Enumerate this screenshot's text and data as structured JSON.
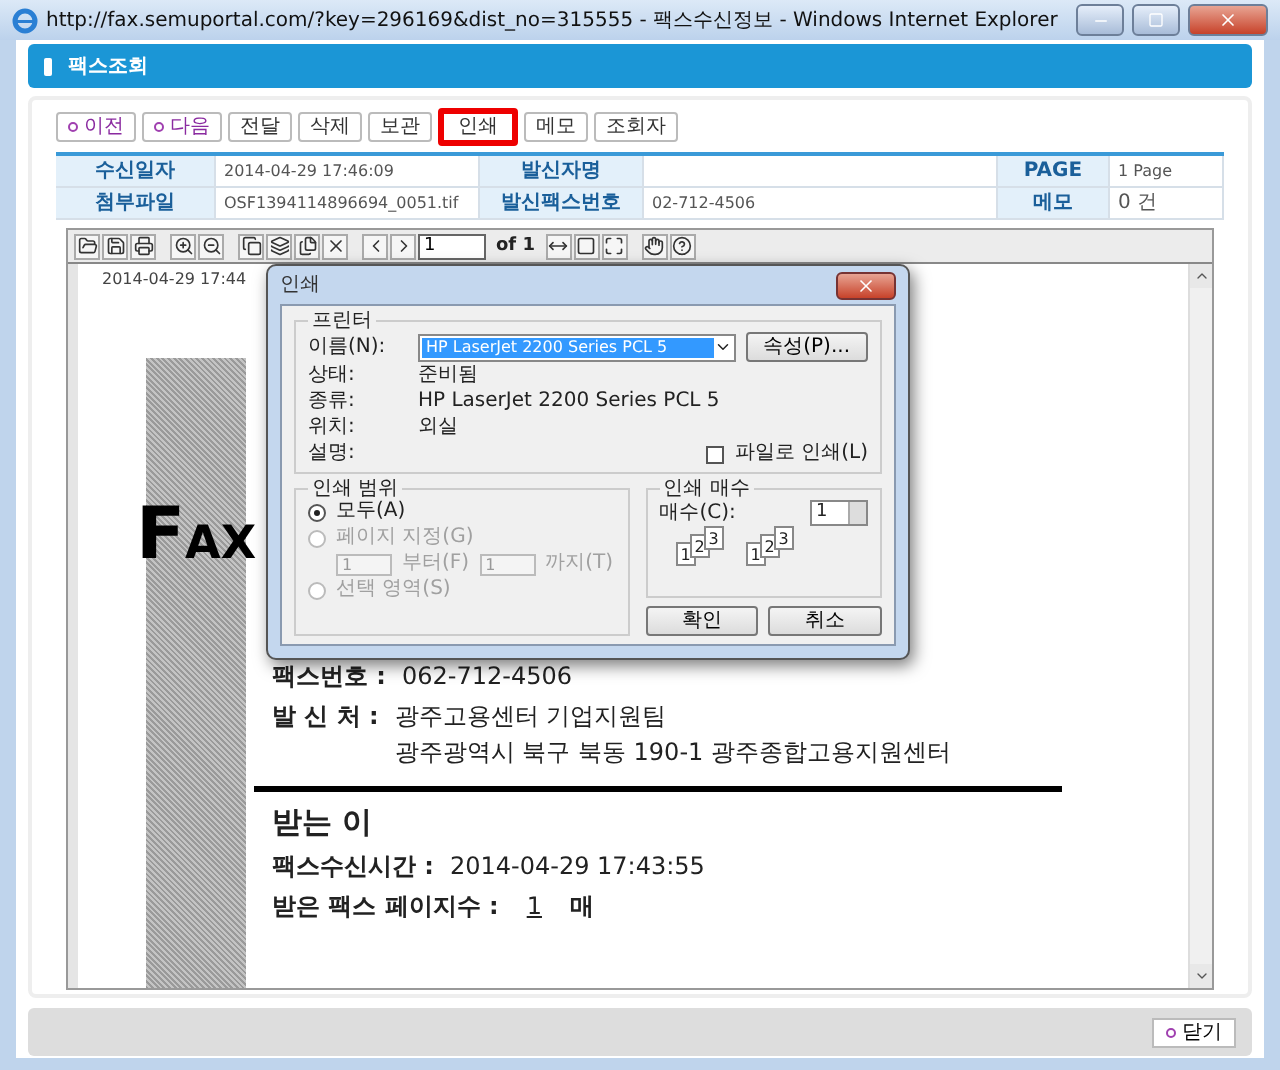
{
  "window": {
    "title": "http://fax.semuportal.com/?key=296169&dist_no=315555 - 팩스수신정보 - Windows Internet Explorer"
  },
  "header": {
    "title": "팩스조회"
  },
  "actions": [
    {
      "label": "이전",
      "kind": "nav",
      "selected": false
    },
    {
      "label": "다음",
      "kind": "nav",
      "selected": false
    },
    {
      "label": "전달",
      "kind": "plain",
      "selected": false
    },
    {
      "label": "삭제",
      "kind": "plain",
      "selected": false
    },
    {
      "label": "보관",
      "kind": "plain",
      "selected": false
    },
    {
      "label": "인쇄",
      "kind": "plain",
      "selected": true
    },
    {
      "label": "메모",
      "kind": "plain",
      "selected": false
    },
    {
      "label": "조회자",
      "kind": "plain",
      "selected": false
    }
  ],
  "info_rows": [
    [
      {
        "label": "수신일자",
        "value": "2014-04-29 17:46:09"
      },
      {
        "label": "발신자명"
      },
      {
        "label": "PAGE",
        "value": "1 Page"
      }
    ],
    [
      {
        "label": "첨부파일",
        "value": "OSF1394114896694_0051.tif"
      },
      {
        "label": "발신팩스번호",
        "value": "02-712-4506"
      },
      {
        "label": "메모",
        "value": "0 건"
      }
    ]
  ],
  "viewer": {
    "page": "1",
    "total": "of 1"
  },
  "document": {
    "timestamp": "2014-04-29 17:44",
    "logo": "FAX",
    "fax_number": {
      "label": "팩스번호 :",
      "value": "062-712-4506"
    },
    "sender": {
      "label": "발 신 처 :",
      "lines": [
        "광주고용센터 기업지원팀",
        "광주광역시 북구 북동 190-1 광주종합고용지원센터"
      ]
    },
    "recipient_heading": "받는 이",
    "received_time": {
      "label": "팩스수신시간 :",
      "value": "2014-04-29 17:43:55"
    },
    "page_count": {
      "label": "받은 팩스 페이지수 :",
      "value": "1",
      "unit": "매"
    }
  },
  "dialog": {
    "title": "인쇄",
    "printer": {
      "legend": "프린터",
      "name_label": "이름(N):",
      "name_value": "HP LaserJet 2200 Series PCL 5",
      "properties_button": "속성(P)...",
      "details": [
        {
          "label": "상태:",
          "value": "준비됨"
        },
        {
          "label": "종류:",
          "value": "HP LaserJet 2200 Series PCL 5"
        },
        {
          "label": "위치:",
          "value": "외실"
        },
        {
          "label": "설명:"
        }
      ],
      "print_to_file": {
        "label": "파일로 인쇄(L)",
        "checked": false
      }
    },
    "range": {
      "legend": "인쇄 범위",
      "options": [
        {
          "label": "모두(A)",
          "selected": true,
          "disabled": false
        },
        {
          "label": "페이지 지정(G)",
          "selected": false,
          "disabled": true
        },
        {
          "label": "선택 영역(S)",
          "selected": false,
          "disabled": true
        }
      ],
      "from_value": "1",
      "from_label": "부터(F)",
      "to_value": "1",
      "to_label": "까지(T)"
    },
    "copies": {
      "legend": "인쇄 매수",
      "label": "매수(C):",
      "value": "1",
      "stacks": [
        [
          "1",
          "2",
          "3"
        ],
        [
          "1",
          "2",
          "3"
        ]
      ]
    },
    "buttons": [
      "확인",
      "취소"
    ]
  },
  "footer": {
    "close_button": "닫기"
  }
}
